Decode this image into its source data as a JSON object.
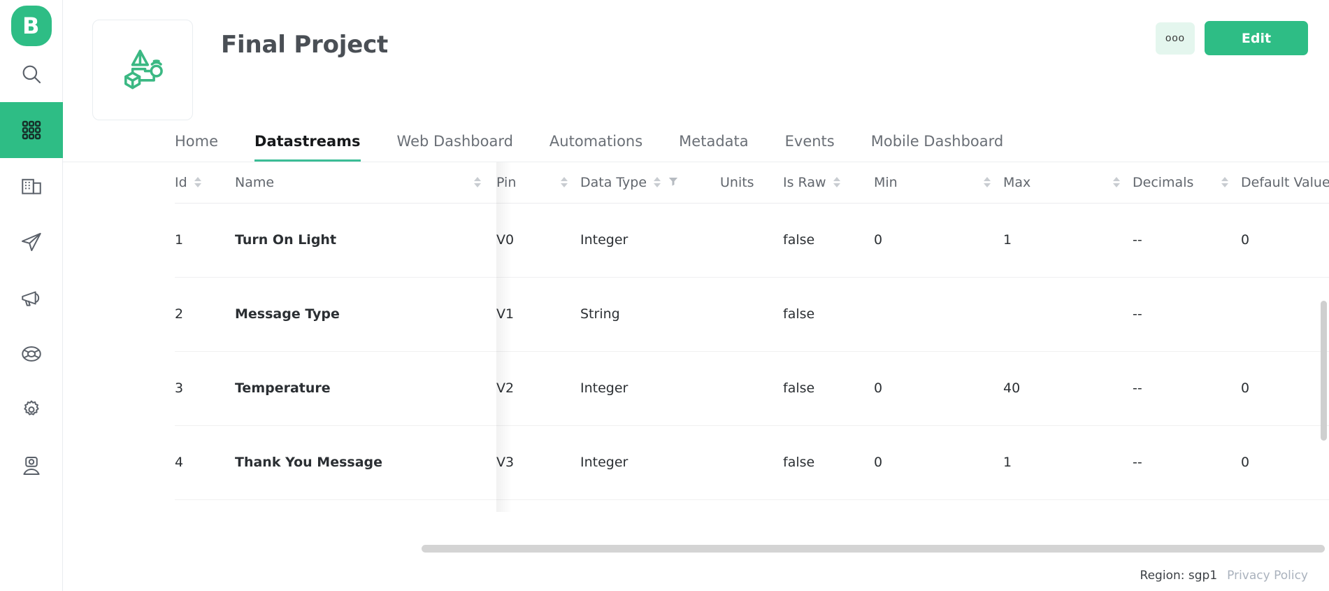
{
  "brand": {
    "logo_letter": "B",
    "accent": "#2ebd85",
    "accent_soft": "#e4f6ee",
    "tab_underline": "#3bbd96"
  },
  "sidebar": {
    "items": [
      {
        "icon": "search-icon",
        "label": "Search",
        "active": false
      },
      {
        "icon": "grid-icon",
        "label": "Devices",
        "active": true
      },
      {
        "icon": "building-icon",
        "label": "Organizations",
        "active": false
      },
      {
        "icon": "send-icon",
        "label": "Messages",
        "active": false
      },
      {
        "icon": "megaphone-icon",
        "label": "Announcements",
        "active": false
      },
      {
        "icon": "lifebuoy-icon",
        "label": "Support",
        "active": false
      },
      {
        "icon": "gear-icon",
        "label": "Settings",
        "active": false
      },
      {
        "icon": "user-icon",
        "label": "Account",
        "active": false
      }
    ]
  },
  "header": {
    "project_title": "Final Project",
    "project_icon": "iot-diagram-icon",
    "more_label": "ooo",
    "edit_label": "Edit"
  },
  "tabs": [
    {
      "label": "Home",
      "active": false
    },
    {
      "label": "Datastreams",
      "active": true
    },
    {
      "label": "Web Dashboard",
      "active": false
    },
    {
      "label": "Automations",
      "active": false
    },
    {
      "label": "Metadata",
      "active": false
    },
    {
      "label": "Events",
      "active": false
    },
    {
      "label": "Mobile Dashboard",
      "active": false
    }
  ],
  "table": {
    "columns": [
      {
        "key": "id",
        "label": "Id",
        "sortable": false,
        "filterable": false
      },
      {
        "key": "name",
        "label": "Name",
        "sortable": true,
        "filterable": false
      },
      {
        "key": "pin",
        "label": "Pin",
        "sortable": true,
        "filterable": false
      },
      {
        "key": "dtype",
        "label": "Data Type",
        "sortable": true,
        "filterable": true
      },
      {
        "key": "units",
        "label": "Units",
        "sortable": false,
        "filterable": false
      },
      {
        "key": "israw",
        "label": "Is Raw",
        "sortable": true,
        "filterable": false
      },
      {
        "key": "min",
        "label": "Min",
        "sortable": true,
        "filterable": false
      },
      {
        "key": "max",
        "label": "Max",
        "sortable": true,
        "filterable": false
      },
      {
        "key": "dec",
        "label": "Decimals",
        "sortable": true,
        "filterable": false
      },
      {
        "key": "def",
        "label": "Default Value",
        "sortable": true,
        "filterable": false
      }
    ],
    "id_sorter_visible": true,
    "rows": [
      {
        "id": "1",
        "name": "Turn On Light",
        "pin": "V0",
        "dtype": "Integer",
        "units": "",
        "israw": "false",
        "min": "0",
        "max": "1",
        "dec": "--",
        "def": "0"
      },
      {
        "id": "2",
        "name": "Message Type",
        "pin": "V1",
        "dtype": "String",
        "units": "",
        "israw": "false",
        "min": "",
        "max": "",
        "dec": "--",
        "def": ""
      },
      {
        "id": "3",
        "name": "Temperature",
        "pin": "V2",
        "dtype": "Integer",
        "units": "",
        "israw": "false",
        "min": "0",
        "max": "40",
        "dec": "--",
        "def": "0"
      },
      {
        "id": "4",
        "name": "Thank You Message",
        "pin": "V3",
        "dtype": "Integer",
        "units": "",
        "israw": "false",
        "min": "0",
        "max": "1",
        "dec": "--",
        "def": "0"
      }
    ]
  },
  "footer": {
    "region": "Region: sgp1",
    "privacy": "Privacy Policy"
  }
}
